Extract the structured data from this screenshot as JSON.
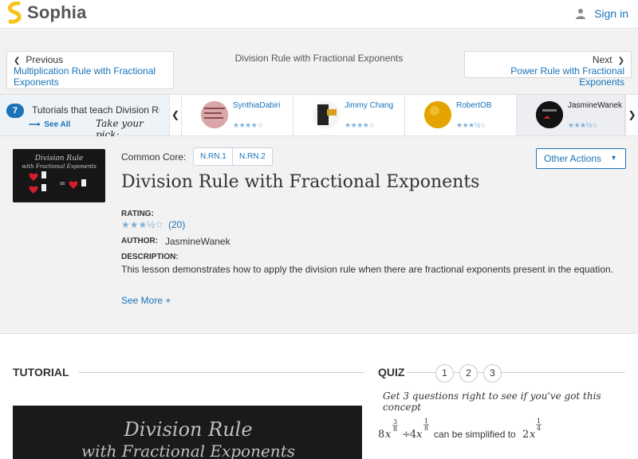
{
  "header": {
    "brand": "Sophia",
    "signin_label": "Sign in",
    "brand_color": "#f5c518"
  },
  "nav": {
    "prev_label": "Previous",
    "prev_link": "Multiplication Rule with Fractional Exponents",
    "center_title": "Division Rule with Fractional Exponents",
    "next_label": "Next",
    "next_link": "Power Rule with Fractional Exponents"
  },
  "strip": {
    "count": "7",
    "teach_text": "Tutorials that teach Division Rule with Fractional Exponents",
    "see_all": "See All",
    "take_pick": "Take your pick:",
    "tutorials": [
      {
        "author": "SynthiaDabiri",
        "stars": "★★★★☆"
      },
      {
        "author": "Jimmy Chang",
        "stars": "★★★★☆"
      },
      {
        "author": "RobertOB",
        "stars": "★★★½☆"
      },
      {
        "author": "JasmineWanek",
        "stars": "★★★½☆"
      }
    ]
  },
  "info": {
    "common_core_label": "Common Core:",
    "standards": [
      "N.RN.1",
      "N.RN.2"
    ],
    "other_actions": "Other Actions",
    "title": "Division Rule with Fractional Exponents",
    "rating_label": "RATING:",
    "rating_stars": "★★★½☆",
    "rating_count": "(20)",
    "author_label": "AUTHOR:",
    "author": "JasmineWanek",
    "description_label": "DESCRIPTION:",
    "description": "This lesson demonstrates how to apply the division rule when there are fractional exponents present in the equation.",
    "see_more": "See More +"
  },
  "tutorial": {
    "heading": "TUTORIAL",
    "video_title_line1": "Division Rule",
    "video_title_line2": "with Fractional Exponents"
  },
  "quiz": {
    "heading": "QUIZ",
    "numbers": [
      "1",
      "2",
      "3"
    ],
    "prompt": "Get 3 questions right to see if you've got this concept",
    "question_text": "can be simplified to"
  }
}
